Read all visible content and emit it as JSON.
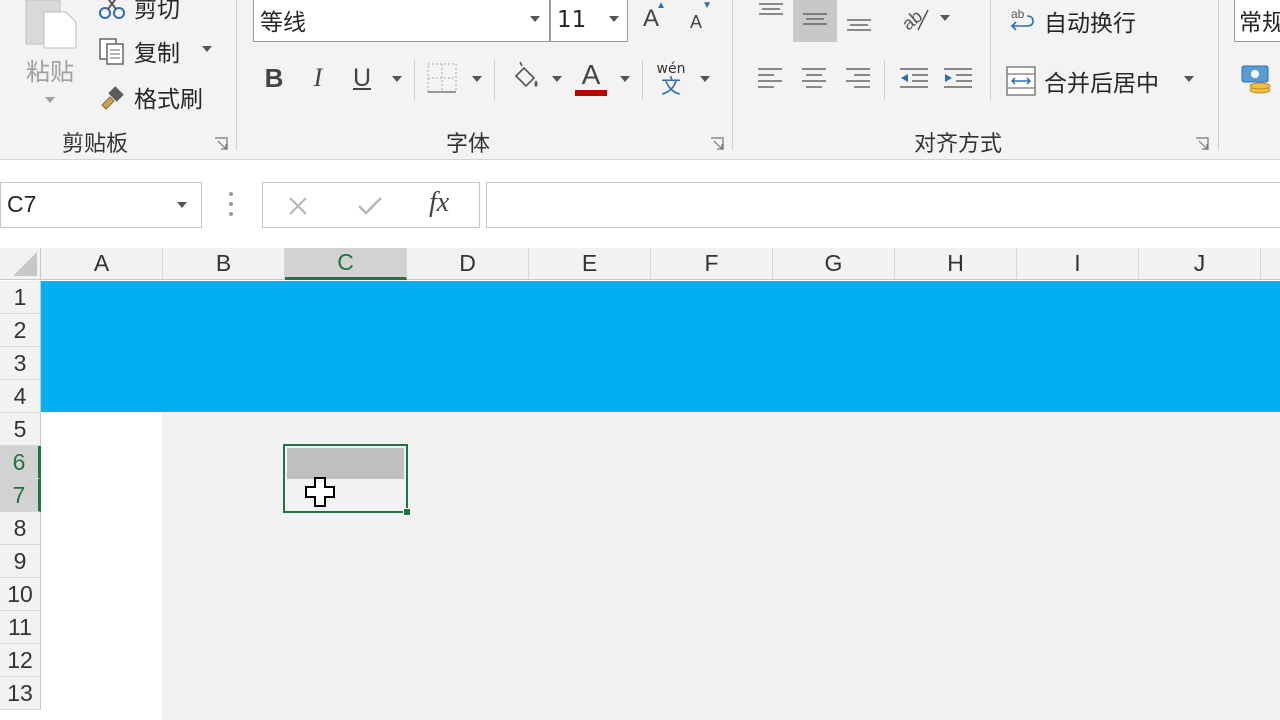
{
  "ribbon": {
    "clipboard": {
      "paste_label": "粘贴",
      "cut_label": "剪切",
      "copy_label": "复制",
      "format_painter_label": "格式刷",
      "group_label": "剪贴板"
    },
    "font": {
      "font_name": "等线",
      "font_size": "11",
      "bold": "B",
      "italic": "I",
      "underline": "U",
      "grow": "A",
      "shrink": "A",
      "font_color_letter": "A",
      "phonetic_top": "wén",
      "phonetic_bottom": "文",
      "group_label": "字体",
      "font_color": "#c00000"
    },
    "alignment": {
      "wrap_text_label": "自动换行",
      "merge_center_label": "合并后居中",
      "group_label": "对齐方式"
    },
    "number": {
      "format_value": "常规"
    }
  },
  "formula_bar": {
    "name_box": "C7",
    "fx": "fx",
    "content": ""
  },
  "grid": {
    "columns": [
      "A",
      "B",
      "C",
      "D",
      "E",
      "F",
      "G",
      "H",
      "I",
      "J"
    ],
    "rows": [
      "1",
      "2",
      "3",
      "4",
      "5",
      "6",
      "7",
      "8",
      "9",
      "10",
      "11",
      "12",
      "13"
    ],
    "selected_column": "C",
    "selected_rows": [
      "6",
      "7"
    ],
    "fill_color": "#00b0f0",
    "accent": "#217346"
  }
}
